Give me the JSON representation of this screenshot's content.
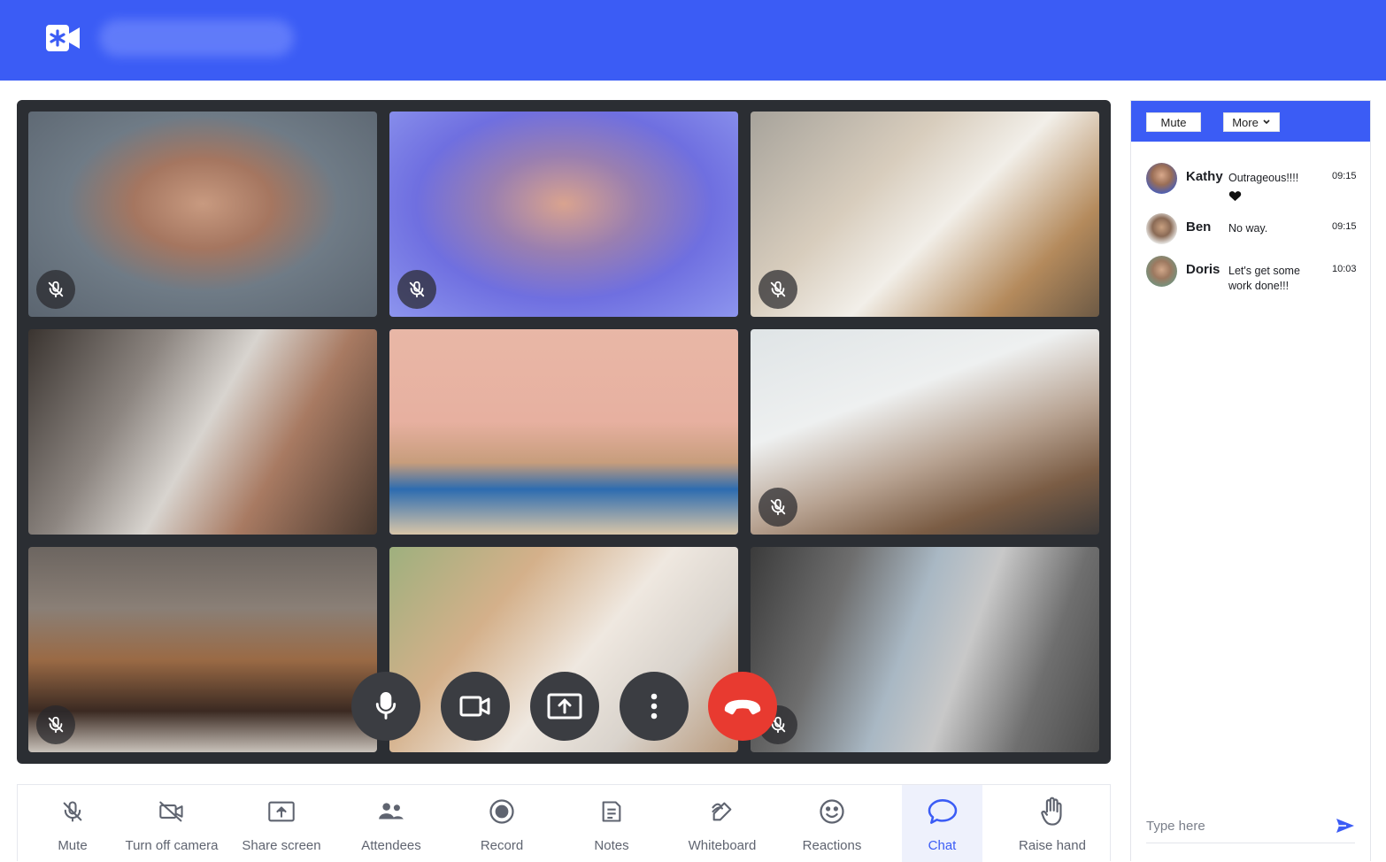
{
  "colors": {
    "brand": "#3b5cf5",
    "stage": "#2b2e33",
    "hangup": "#e83a30"
  },
  "header": {
    "logo_icon": "video-camera-asterisk-icon"
  },
  "participants": [
    {
      "tile": "participant-1",
      "muted": true
    },
    {
      "tile": "participant-2",
      "muted": true
    },
    {
      "tile": "participant-3",
      "muted": true
    },
    {
      "tile": "participant-4",
      "muted": false
    },
    {
      "tile": "participant-5",
      "muted": false,
      "active_speaker": true
    },
    {
      "tile": "participant-6",
      "muted": true
    },
    {
      "tile": "participant-7",
      "muted": true
    },
    {
      "tile": "participant-8",
      "muted": false
    },
    {
      "tile": "participant-9",
      "muted": true
    }
  ],
  "call_controls": [
    "microphone-icon",
    "camera-icon",
    "screen-share-icon",
    "more-vertical-icon",
    "hang-up-icon"
  ],
  "toolbar": {
    "items": [
      {
        "label": "Mute",
        "icon": "mic-off-icon"
      },
      {
        "label": "Turn off camera",
        "icon": "camera-off-icon"
      },
      {
        "label": "Share screen",
        "icon": "share-screen-icon"
      },
      {
        "label": "Attendees",
        "icon": "attendees-icon"
      },
      {
        "label": "Record",
        "icon": "record-icon"
      },
      {
        "label": "Notes",
        "icon": "notes-icon"
      },
      {
        "label": "Whiteboard",
        "icon": "whiteboard-icon"
      },
      {
        "label": "Reactions",
        "icon": "reactions-icon"
      },
      {
        "label": "Chat",
        "icon": "chat-icon",
        "selected": true
      },
      {
        "label": "Raise hand",
        "icon": "raise-hand-icon"
      }
    ]
  },
  "chat": {
    "mute_label": "Mute",
    "more_label": "More",
    "messages": [
      {
        "name": "Kathy",
        "text": "Outrageous!!!!",
        "time": "09:15",
        "reaction": "heart-icon"
      },
      {
        "name": "Ben",
        "text": "No way.",
        "time": "09:15"
      },
      {
        "name": "Doris",
        "text": "Let's get some work done!!!",
        "time": "10:03"
      }
    ],
    "input_placeholder": "Type here"
  }
}
